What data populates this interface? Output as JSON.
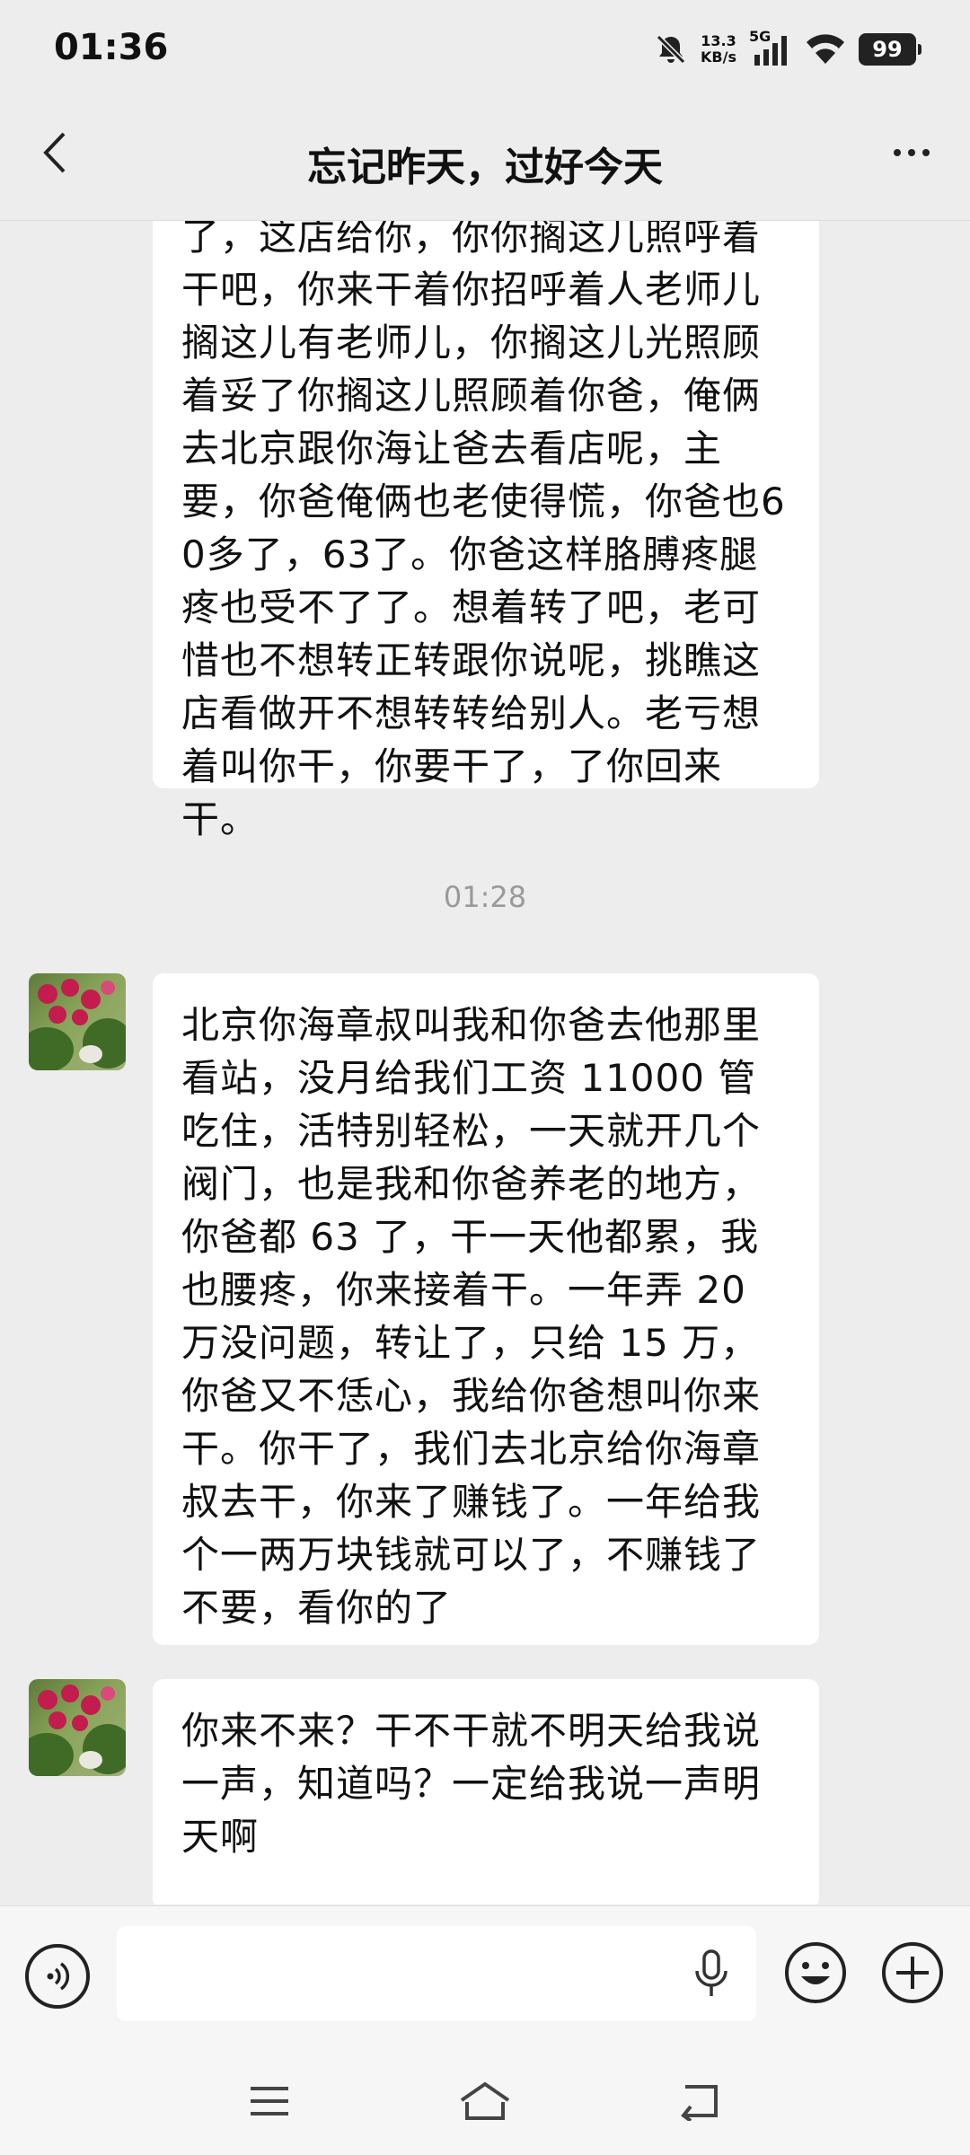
{
  "status": {
    "time": "01:36",
    "speed_value": "13.3",
    "speed_unit": "KB/s",
    "network": "5G",
    "battery": "99"
  },
  "header": {
    "title": "忘记昨天，过好今天"
  },
  "messages": [
    {
      "text": "了，这店给你，你你搁这儿照呼着干吧，你来干着你招呼着人老师儿搁这儿有老师儿，你搁这儿光照顾着妥了你搁这儿照顾着你爸，俺俩去北京跟你海让爸去看店呢，主要，你爸俺俩也老使得慌，你爸也60多了，63了。你爸这样胳膊疼腿疼也受不了了。想着转了吧，老可惜也不想转正转跟你说呢，挑瞧这店看做开不想转转给别人。老亏想着叫你干，你要干了，了你回来干。"
    },
    {
      "text": "北京你海章叔叫我和你爸去他那里看站，没月给我们工资 11000 管吃住，活特别轻松，一天就开几个阀门，也是我和你爸养老的地方，你爸都 63 了，干一天他都累，我也腰疼，你来接着干。一年弄 20 万没问题，转让了，只给 15 万，你爸又不恁心，我给你爸想叫你来干。你干了，我们去北京给你海章叔去干，你来了赚钱了。一年给我个一两万块钱就可以了，不赚钱了不要，看你的了"
    },
    {
      "text": "你来不来？干不干就不明天给我说一声，知道吗？一定给我说一声明天啊"
    }
  ],
  "timestamp": "01:28",
  "icons": {
    "back": "chevron-left-icon",
    "more": "more-icon",
    "voice": "voice-icon",
    "mic": "mic-icon",
    "emoji": "emoji-icon",
    "plus": "plus-icon",
    "nav_menu": "menu-icon",
    "nav_home": "home-icon",
    "nav_back": "back-icon"
  }
}
